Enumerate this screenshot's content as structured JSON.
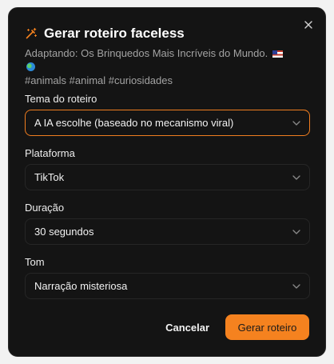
{
  "dialog": {
    "title": "Gerar roteiro faceless",
    "subtitle": "Adaptando: Os Brinquedos Mais Incríveis do Mundo.",
    "hashtags": "#animals #animal #curiosidades",
    "accent_color": "#f5821f",
    "title_icon": "magic-wand-icon",
    "close_icon": "close-icon"
  },
  "fields": {
    "tema": {
      "label": "Tema do roteiro",
      "value": "A IA escolhe (baseado no mecanismo viral)"
    },
    "plataforma": {
      "label": "Plataforma",
      "value": "TikTok"
    },
    "duracao": {
      "label": "Duração",
      "value": "30 segundos"
    },
    "tom": {
      "label": "Tom",
      "value": "Narração misteriosa"
    }
  },
  "actions": {
    "cancel": "Cancelar",
    "generate": "Gerar roteiro"
  }
}
